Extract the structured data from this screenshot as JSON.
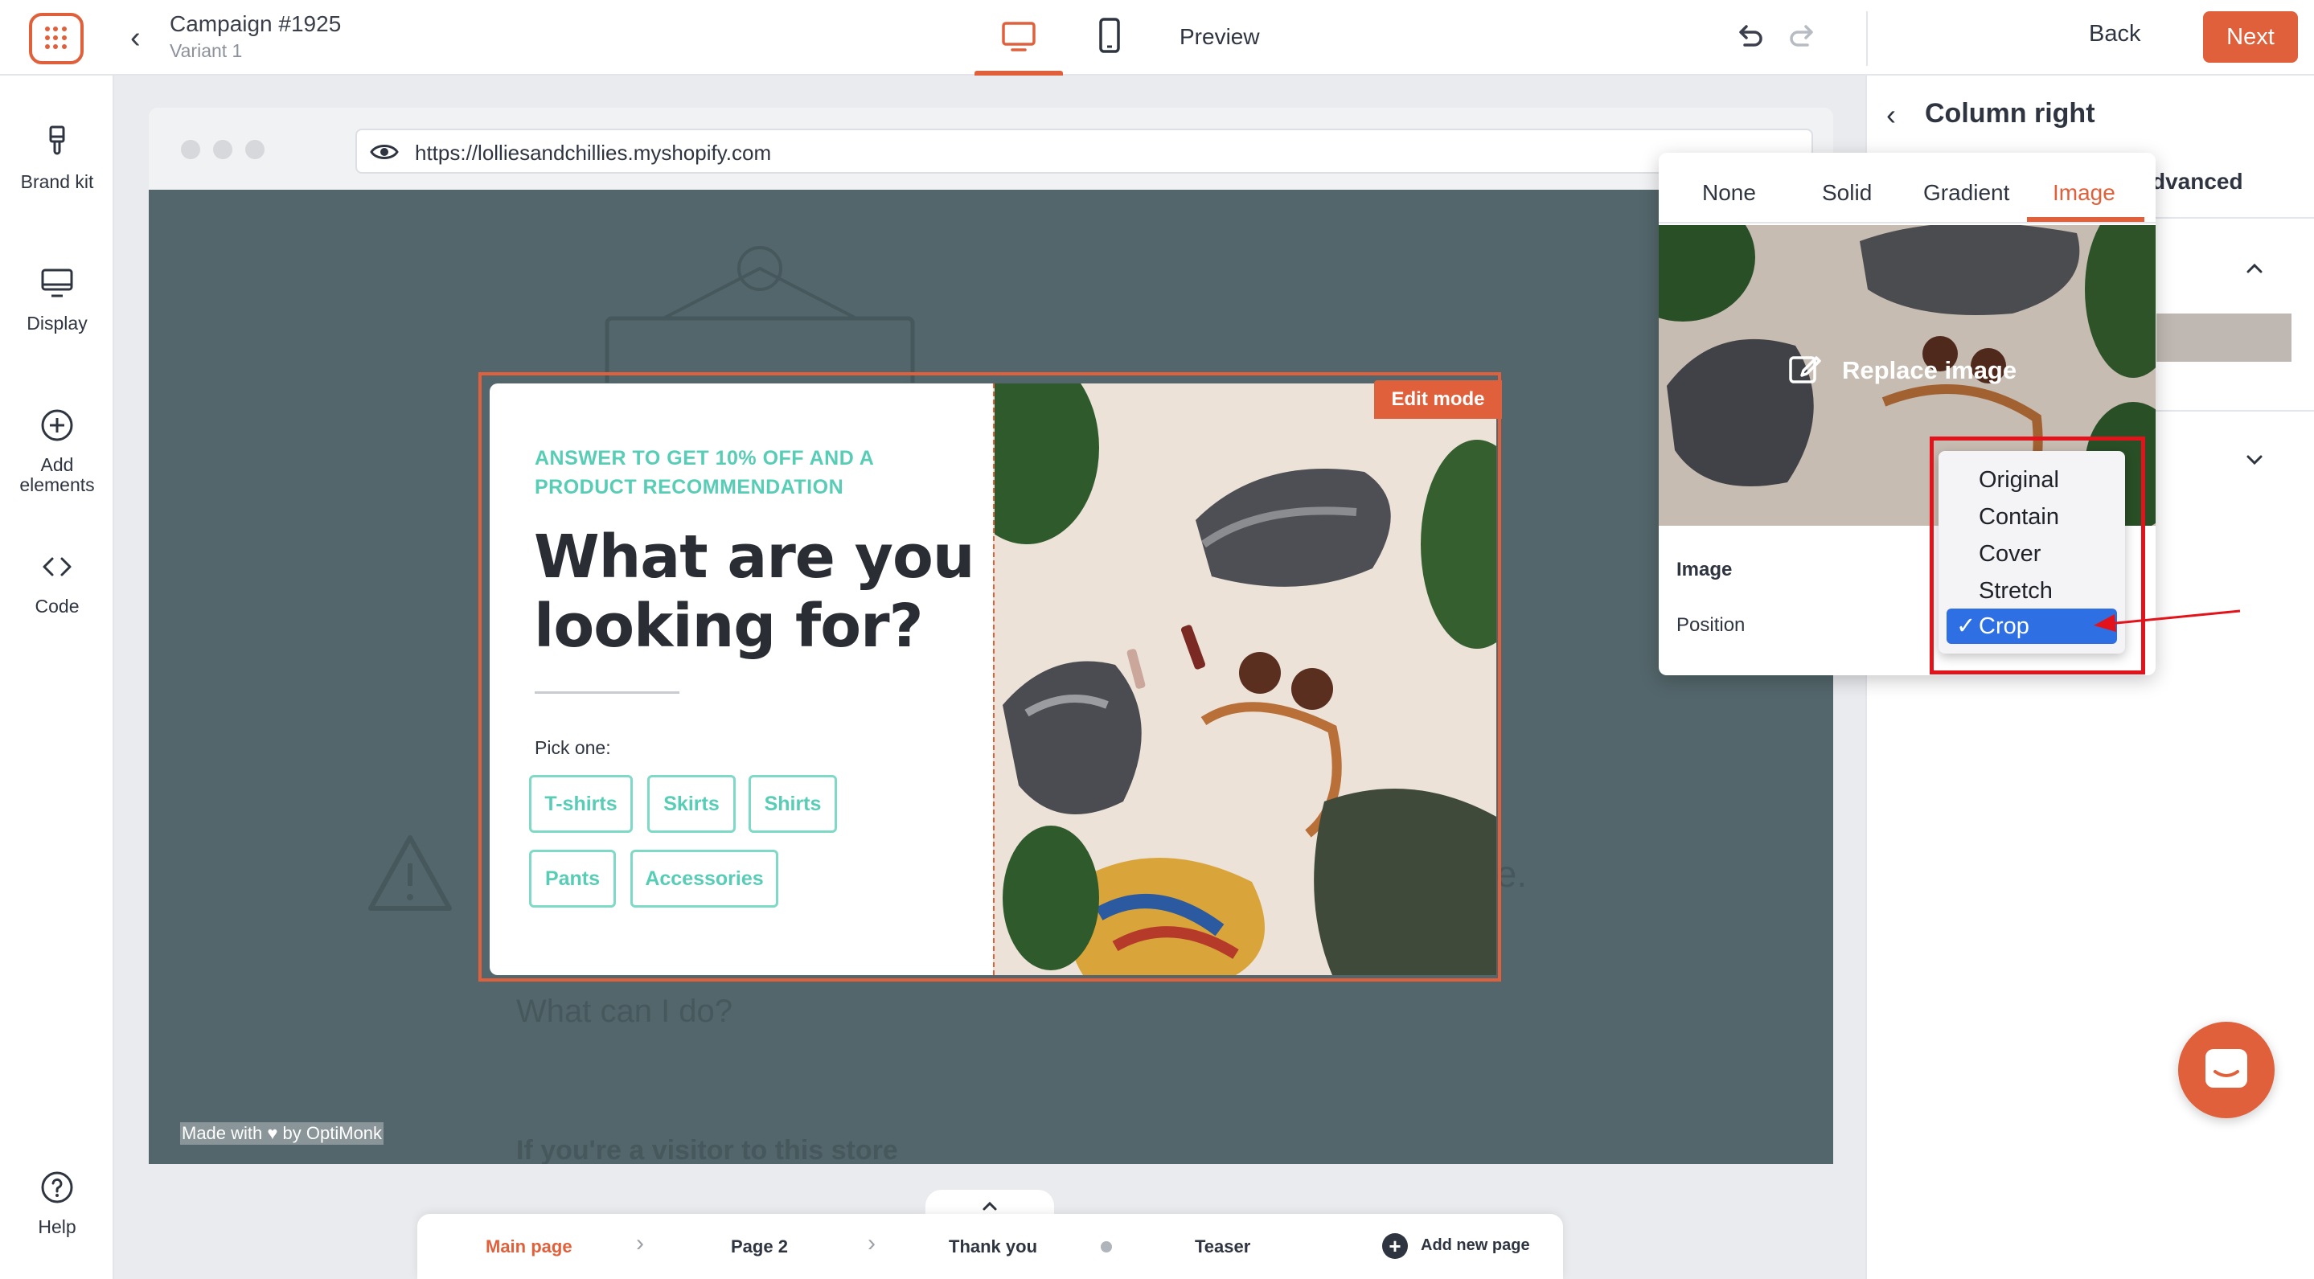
{
  "header": {
    "campaign_title": "Campaign #1925",
    "variant": "Variant 1",
    "preview_label": "Preview",
    "back_label": "Back",
    "next_label": "Next"
  },
  "sidebar": {
    "items": [
      {
        "label": "Brand kit",
        "icon": "brush-icon"
      },
      {
        "label": "Display",
        "icon": "monitor-icon"
      },
      {
        "label": "Add elements",
        "icon": "plus-circle-icon"
      },
      {
        "label": "Code",
        "icon": "code-icon"
      },
      {
        "label": "Help",
        "icon": "help-icon"
      }
    ]
  },
  "browser": {
    "url": "https://lolliesandchillies.myshopify.com"
  },
  "site": {
    "ghost_heading": "What can I do?",
    "ghost_sub": "If you're a visitor to this store",
    "ghost_text": "ble.",
    "made_with": "Made with ♥ by OptiMonk"
  },
  "popup": {
    "edit_mode": "Edit mode",
    "kicker": "ANSWER TO GET 10% OFF AND A PRODUCT RECOMMENDATION",
    "headline": "What are you looking for?",
    "pick_label": "Pick one:",
    "chips": [
      "T-shirts",
      "Skirts",
      "Shirts",
      "Pants",
      "Accessories"
    ]
  },
  "pages_nav": {
    "pages": [
      "Main page",
      "Page 2",
      "Thank you",
      "Teaser"
    ],
    "add_page": "Add new page",
    "active_color": "#e0603b"
  },
  "right_panel": {
    "title": "Column right",
    "advanced_tab": "dvanced"
  },
  "background_popover": {
    "tabs": [
      "None",
      "Solid",
      "Gradient",
      "Image"
    ],
    "active_tab": "Image",
    "replace_image": "Replace image",
    "image_label": "Image",
    "position_label": "Position"
  },
  "position_dropdown": {
    "options": [
      "Original",
      "Contain",
      "Cover",
      "Stretch",
      "Crop"
    ],
    "selected": "Crop",
    "check": "✓"
  },
  "colors": {
    "accent": "#e0603b",
    "teal": "#58cdb6",
    "site_bg": "#53666b",
    "select_blue": "#2f6fe4",
    "annotation_red": "#e3131b"
  }
}
